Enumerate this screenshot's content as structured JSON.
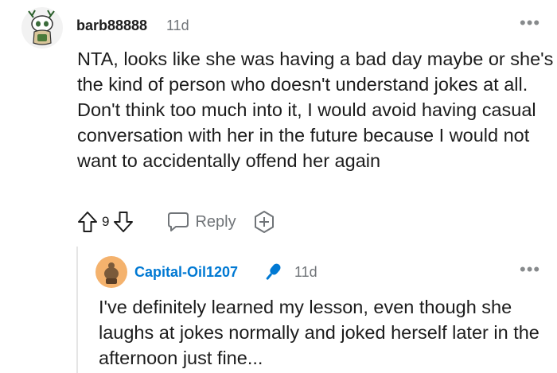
{
  "comment": {
    "username": "barb88888",
    "age": "11d",
    "body": "NTA, looks like she was having a bad day maybe or she's the kind of person who doesn't understand jokes at all. Don't think too much into it, I would avoid having casual conversation with her in the future because I would not want to accidentally offend her again",
    "vote_count": "9",
    "reply_label": "Reply",
    "more_glyph": "•••",
    "avatar_icon": "snoo-avatar-icon"
  },
  "reply": {
    "username": "Capital-Oil1207",
    "age": "11d",
    "body": "I've definitely learned my lesson, even though she laughs at jokes normally and joked herself later in the afternoon just fine...",
    "more_glyph": "•••",
    "badge_icon": "microphone-icon"
  },
  "colors": {
    "username_reply": "#0079d3",
    "meta_gray": "#707478",
    "mic_blue": "#0079d3",
    "avatar2_bg": "#f4b26d"
  }
}
